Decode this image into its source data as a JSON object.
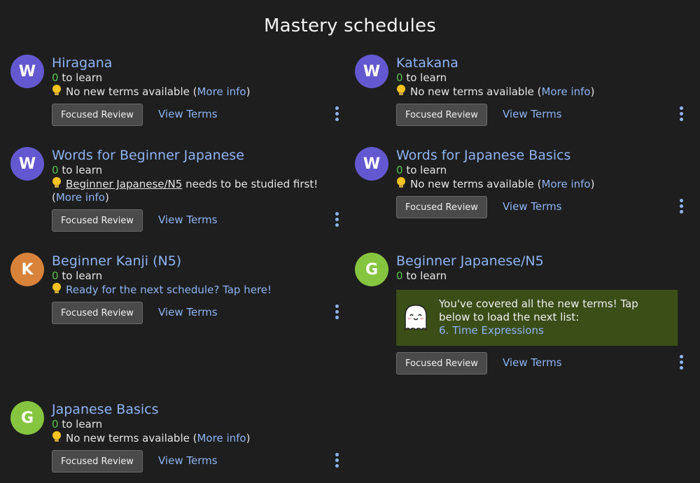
{
  "page_title": "Mastery schedules",
  "labels": {
    "to_learn": "to learn",
    "focused_review": "Focused Review",
    "view_terms": "View Terms",
    "more_info": "More info",
    "no_new_terms": "No new terms available (",
    "close_paren": ")"
  },
  "colors": {
    "avatar_purple": "#6458d0",
    "avatar_orange": "#d8823a",
    "avatar_green": "#86c540",
    "banner": "#3c4e18",
    "link": "#8fb4f2",
    "count": "#57c24d"
  },
  "schedules": [
    {
      "letter": "W",
      "name": "Hiragana",
      "count": "0"
    },
    {
      "letter": "W",
      "name": "Katakana",
      "count": "0"
    },
    {
      "letter": "W",
      "name": "Words for Beginner Japanese",
      "count": "0",
      "prereq_name": "Beginner Japanese/N5",
      "prereq_text": "needs to be studied first!",
      "open_paren": "("
    },
    {
      "letter": "W",
      "name": "Words for Japanese Basics",
      "count": "0"
    },
    {
      "letter": "K",
      "name": "Beginner Kanji (N5)",
      "count": "0",
      "next_text": "Ready for the next schedule? Tap here!"
    },
    {
      "letter": "G",
      "name": "Beginner Japanese/N5",
      "count": "0",
      "banner_text": "You've covered all the new terms! Tap below to load the next list:",
      "banner_link": "6. Time Expressions"
    },
    {
      "letter": "G",
      "name": "Japanese Basics",
      "count": "0"
    }
  ]
}
